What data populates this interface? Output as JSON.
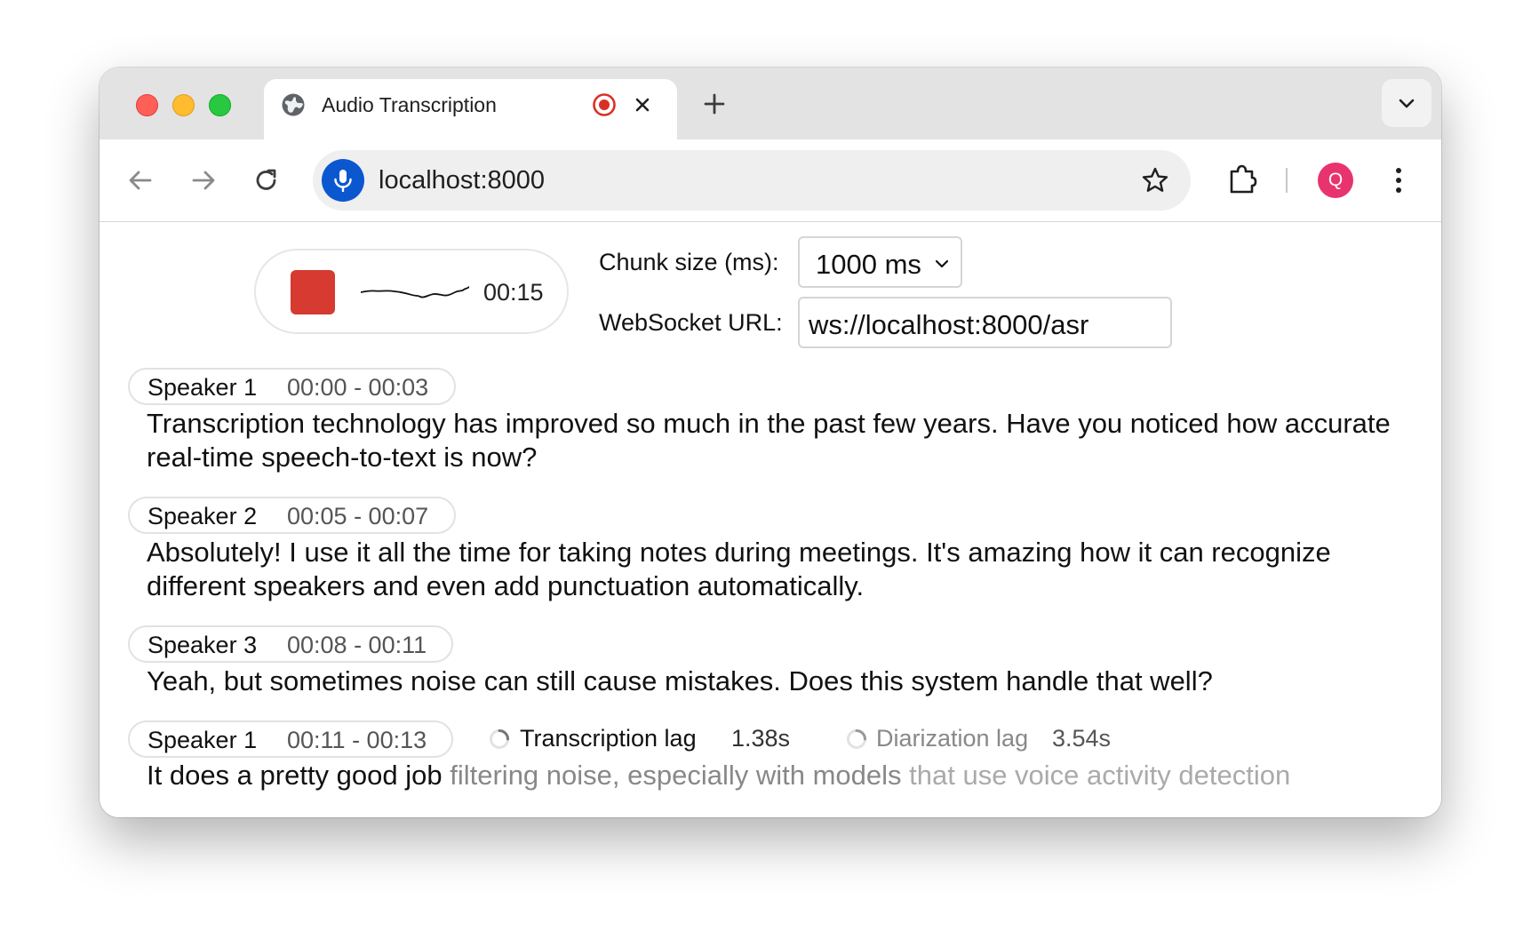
{
  "browser": {
    "tab_title": "Audio Transcription",
    "url": "localhost:8000",
    "avatar_initial": "Q",
    "colors": {
      "recording_badge": "#d93025",
      "mic_badge": "#0b57d0",
      "avatar": "#e8336e"
    }
  },
  "recorder": {
    "timer": "00:15",
    "stop_color": "#d63a30"
  },
  "settings": {
    "chunk_label": "Chunk size (ms):",
    "chunk_value": "1000 ms",
    "ws_label": "WebSocket URL:",
    "ws_value": "ws://localhost:8000/asr"
  },
  "segments": [
    {
      "speaker": "Speaker 1",
      "time": "00:00 - 00:03",
      "text": "Transcription technology has improved so much in the past few years. Have you noticed how accurate real-time speech-to-text is now?"
    },
    {
      "speaker": "Speaker 2",
      "time": "00:05 - 00:07",
      "text": "Absolutely! I use it all the time for taking notes during meetings. It's amazing how it can recognize different speakers and even add punctuation automatically."
    },
    {
      "speaker": "Speaker 3",
      "time": "00:08 - 00:11",
      "text": "Yeah, but sometimes noise can still cause mistakes. Does this system handle that well?"
    },
    {
      "speaker": "Speaker 1",
      "time": "00:11 - 00:13",
      "text_final": "It does a pretty good job",
      "text_pending": " filtering noise, especially with models",
      "text_buffer": " that use voice activity detection"
    }
  ],
  "status": {
    "transcription_lag_label": "Transcription lag",
    "transcription_lag_value": "1.38s",
    "diarization_lag_label": "Diarization lag",
    "diarization_lag_value": "3.54s"
  }
}
